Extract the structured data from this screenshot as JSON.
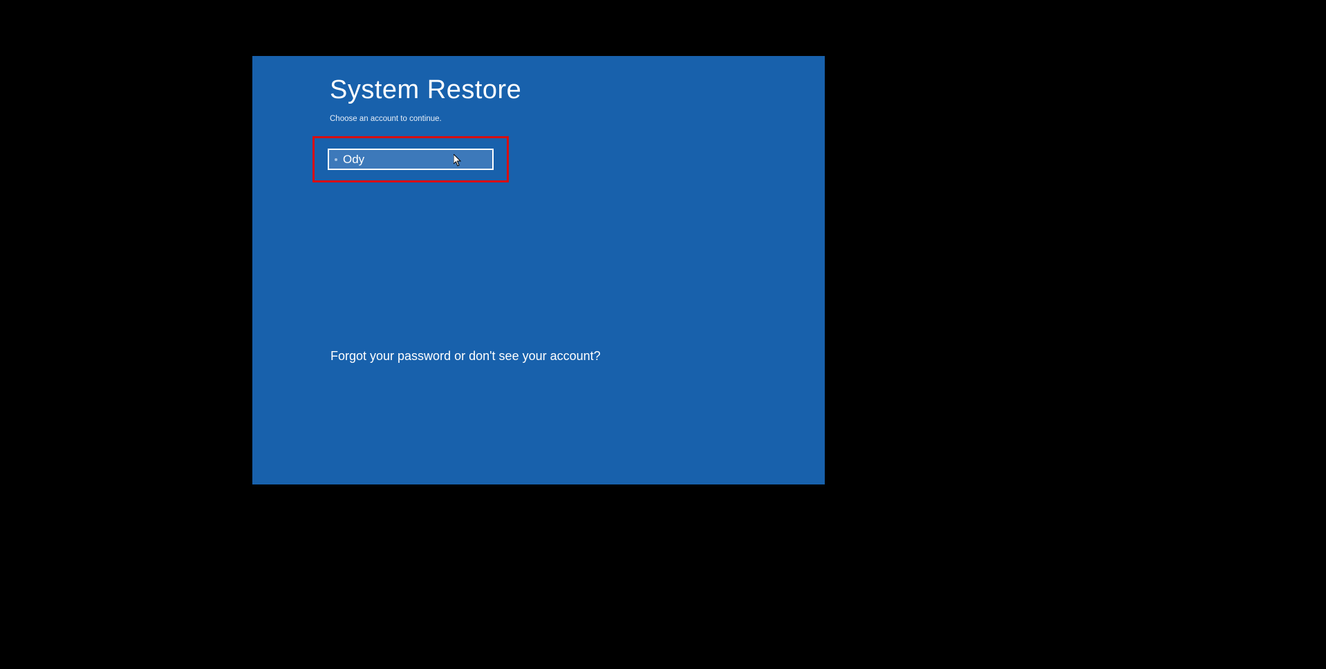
{
  "title": "System Restore",
  "subtitle": "Choose an account to continue.",
  "accounts": [
    {
      "name": "Ody"
    }
  ],
  "forgot_text": "Forgot your password or don't see your account?",
  "colors": {
    "panel_bg": "#1861ac",
    "highlight_border": "#d80e0e",
    "button_bg": "#3d79ba"
  }
}
